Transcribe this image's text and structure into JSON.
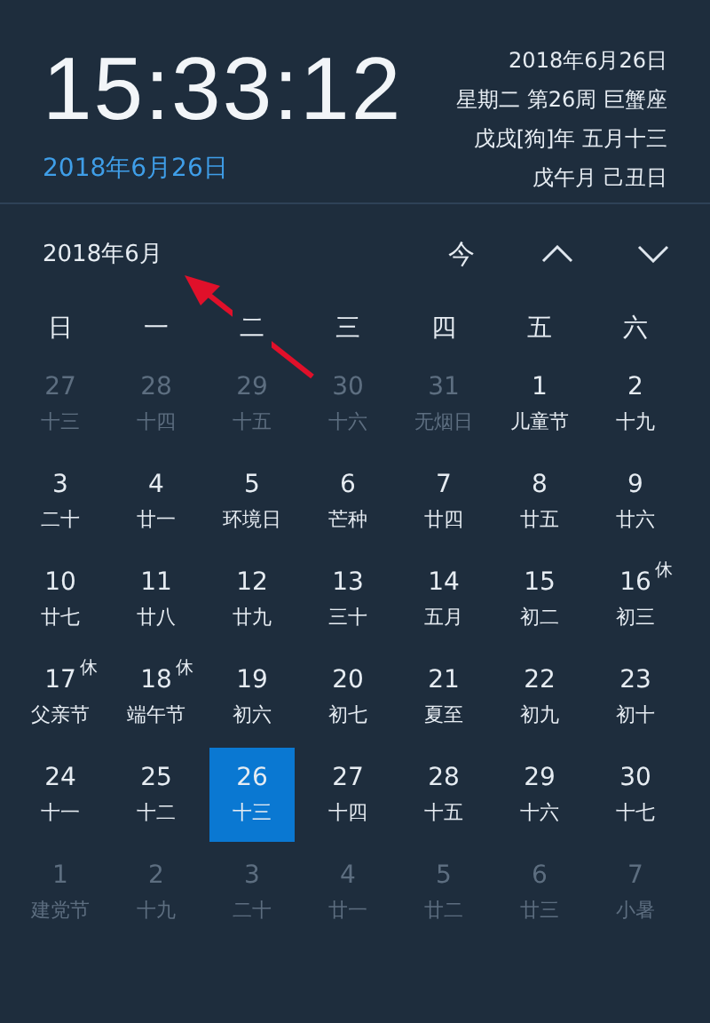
{
  "clock": {
    "time": "15:33:12",
    "date": "2018年6月26日"
  },
  "info_lines": [
    "2018年6月26日",
    "星期二 第26周 巨蟹座",
    "戊戌[狗]年 五月十三",
    "戊午月 己丑日"
  ],
  "month_title": "2018年6月",
  "nav_buttons": [
    {
      "kind": "today",
      "label": "今"
    },
    {
      "kind": "prev"
    },
    {
      "kind": "next"
    }
  ],
  "weekdays": [
    "日",
    "一",
    "二",
    "三",
    "四",
    "五",
    "六"
  ],
  "days": [
    {
      "day": "27",
      "sub": "十三",
      "current": false,
      "selected": false
    },
    {
      "day": "28",
      "sub": "十四",
      "current": false,
      "selected": false
    },
    {
      "day": "29",
      "sub": "十五",
      "current": false,
      "selected": false
    },
    {
      "day": "30",
      "sub": "十六",
      "current": false,
      "selected": false
    },
    {
      "day": "31",
      "sub": "无烟日",
      "current": false,
      "selected": false
    },
    {
      "day": "1",
      "sub": "儿童节",
      "current": true,
      "selected": false
    },
    {
      "day": "2",
      "sub": "十九",
      "current": true,
      "selected": false
    },
    {
      "day": "3",
      "sub": "二十",
      "current": true,
      "selected": false
    },
    {
      "day": "4",
      "sub": "廿一",
      "current": true,
      "selected": false
    },
    {
      "day": "5",
      "sub": "环境日",
      "current": true,
      "selected": false
    },
    {
      "day": "6",
      "sub": "芒种",
      "current": true,
      "selected": false
    },
    {
      "day": "7",
      "sub": "廿四",
      "current": true,
      "selected": false
    },
    {
      "day": "8",
      "sub": "廿五",
      "current": true,
      "selected": false
    },
    {
      "day": "9",
      "sub": "廿六",
      "current": true,
      "selected": false
    },
    {
      "day": "10",
      "sub": "廿七",
      "current": true,
      "selected": false
    },
    {
      "day": "11",
      "sub": "廿八",
      "current": true,
      "selected": false
    },
    {
      "day": "12",
      "sub": "廿九",
      "current": true,
      "selected": false
    },
    {
      "day": "13",
      "sub": "三十",
      "current": true,
      "selected": false
    },
    {
      "day": "14",
      "sub": "五月",
      "current": true,
      "selected": false
    },
    {
      "day": "15",
      "sub": "初二",
      "current": true,
      "selected": false
    },
    {
      "day": "16",
      "sub": "初三",
      "current": true,
      "selected": false,
      "badge": "休"
    },
    {
      "day": "17",
      "sub": "父亲节",
      "current": true,
      "selected": false,
      "badge": "休"
    },
    {
      "day": "18",
      "sub": "端午节",
      "current": true,
      "selected": false,
      "badge": "休"
    },
    {
      "day": "19",
      "sub": "初六",
      "current": true,
      "selected": false
    },
    {
      "day": "20",
      "sub": "初七",
      "current": true,
      "selected": false
    },
    {
      "day": "21",
      "sub": "夏至",
      "current": true,
      "selected": false
    },
    {
      "day": "22",
      "sub": "初九",
      "current": true,
      "selected": false
    },
    {
      "day": "23",
      "sub": "初十",
      "current": true,
      "selected": false
    },
    {
      "day": "24",
      "sub": "十一",
      "current": true,
      "selected": false
    },
    {
      "day": "25",
      "sub": "十二",
      "current": true,
      "selected": false
    },
    {
      "day": "26",
      "sub": "十三",
      "current": true,
      "selected": true
    },
    {
      "day": "27",
      "sub": "十四",
      "current": true,
      "selected": false
    },
    {
      "day": "28",
      "sub": "十五",
      "current": true,
      "selected": false
    },
    {
      "day": "29",
      "sub": "十六",
      "current": true,
      "selected": false
    },
    {
      "day": "30",
      "sub": "十七",
      "current": true,
      "selected": false
    },
    {
      "day": "1",
      "sub": "建党节",
      "current": false,
      "selected": false
    },
    {
      "day": "2",
      "sub": "十九",
      "current": false,
      "selected": false
    },
    {
      "day": "3",
      "sub": "二十",
      "current": false,
      "selected": false
    },
    {
      "day": "4",
      "sub": "廿一",
      "current": false,
      "selected": false
    },
    {
      "day": "5",
      "sub": "廿二",
      "current": false,
      "selected": false
    },
    {
      "day": "6",
      "sub": "廿三",
      "current": false,
      "selected": false
    },
    {
      "day": "7",
      "sub": "小暑",
      "current": false,
      "selected": false
    }
  ]
}
